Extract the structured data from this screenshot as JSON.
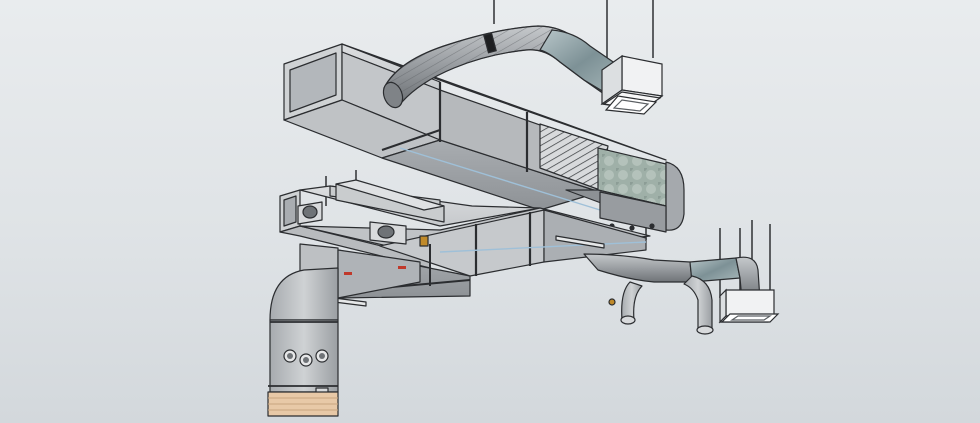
{
  "scene": {
    "colors": {
      "background_top": "#e9ecee",
      "background_bottom": "#d3d8dc",
      "duct_light": "#d2d4d6",
      "duct_mid": "#b9bcbf",
      "duct_dark": "#8f9397",
      "outline": "#2b2d30",
      "flex_foil": "#8fa3a8",
      "filter_mesh": "#9fb3a8",
      "canvas_sleeve": "#e8c9a7",
      "diffuser_white": "#f3f4f5",
      "rod": "#3a3c3f",
      "valve_handle": "#c08a2a",
      "tag_red": "#c0392b"
    },
    "icons": [
      "rectangular-duct",
      "flexible-round-duct",
      "ceiling-square-diffuser",
      "fan-coil-filter-section",
      "duct-elbow-riser",
      "volume-damper",
      "hanger-rod"
    ]
  }
}
